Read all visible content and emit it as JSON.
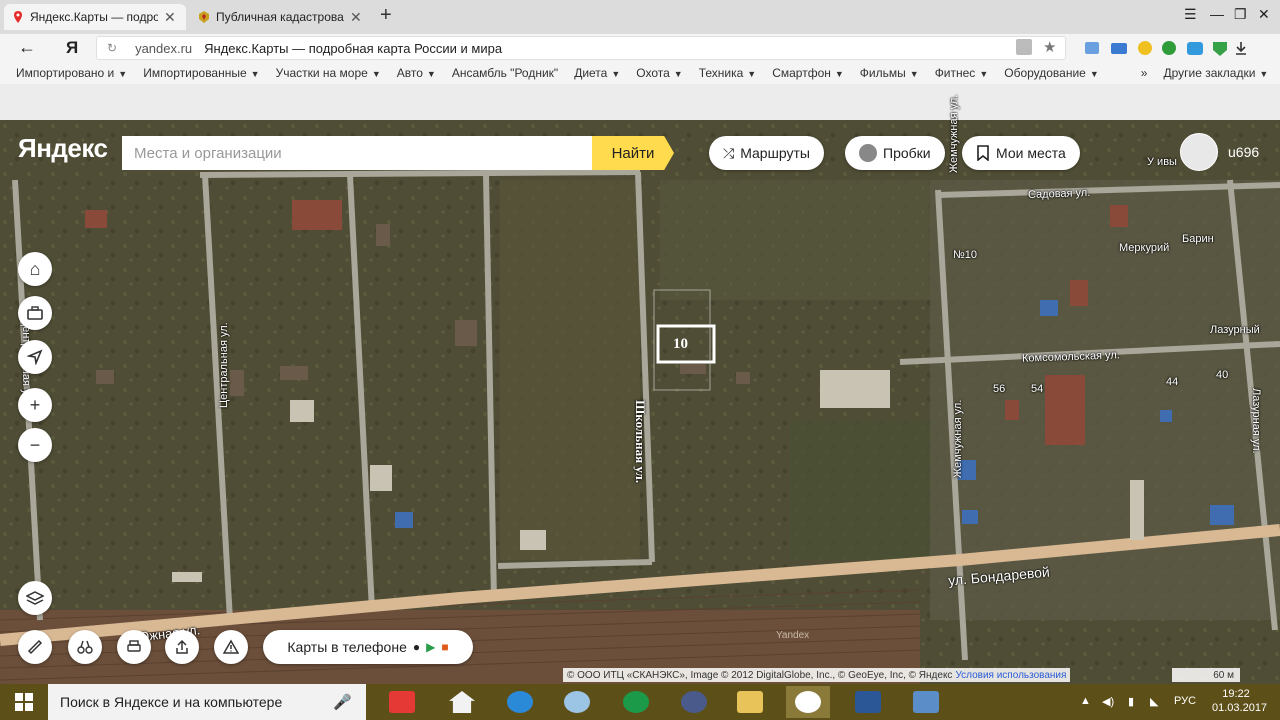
{
  "browser": {
    "tabs": [
      {
        "title": "Яндекс.Карты — подроб",
        "close": "✕",
        "active": true
      },
      {
        "title": "Публичная кадастровая ка",
        "close": "✕",
        "active": false
      }
    ],
    "new_tab": "+",
    "address": {
      "domain": "yandex.ru",
      "title": "Яндекс.Карты — подробная карта России и мира"
    },
    "yandex_logo": "Я",
    "bookmarks": [
      "Импортировано и",
      "Импортированные",
      "Участки на море",
      "Авто",
      "Ансамбль \"Родник\"",
      "Диета",
      "Охота",
      "Техника",
      "Смартфон",
      "Фильмы",
      "Фитнес",
      "Оборудование"
    ],
    "more_bookmarks": "»",
    "other_bookmarks": "Другие закладки"
  },
  "map_ui": {
    "logo": "Яндекс",
    "search_placeholder": "Места и организации",
    "search_button": "Найти",
    "routes": "Маршруты",
    "traffic": "Пробки",
    "my_places": "Мои места",
    "user": "u696",
    "phone_promo": "Карты в телефоне",
    "copyright": "© ООО ИТЦ «СКАНЭКС», Image © 2012 DigitalGlobe, Inc., © GeoEye, Inc, © Яндекс",
    "terms": "Условия использования",
    "scale": "60 м",
    "watermark": "Yandex"
  },
  "map_labels": {
    "plot_number": "10",
    "street_school": "Школьная ул.",
    "street_central": "Центральная ул.",
    "street_central2": "Центральная ул.",
    "street_south": "Южная ул.",
    "street_bondareva": "ул. Бондаревой",
    "street_sadovaya": "Садовая ул.",
    "street_komsomol": "Комсомольская ул.",
    "street_zhemchuzh": "Жемчужная ул.",
    "street_zhemchuzh2": "Жемчужная ул.",
    "street_lazurnaya": "Лазурная ул.",
    "poi_merkuriy": "Меркурий",
    "poi_barin": "Барин",
    "poi_lazurny": "Лазурный",
    "poi_u_ivy": "У ивы",
    "house_10": "№10",
    "house_56": "56",
    "house_54": "54",
    "house_44": "44",
    "house_40": "40"
  },
  "taskbar": {
    "search_text": "Поиск в Яндексе и на компьютере",
    "lang": "РУС",
    "time": "19:22",
    "date": "01.03.2017"
  },
  "colors": {
    "search_button": "#ffdb4d",
    "map_ground": "#4e4c34",
    "road": "#a9a69a",
    "highway": "#d8b994",
    "taskbar": "#5d4f18"
  }
}
